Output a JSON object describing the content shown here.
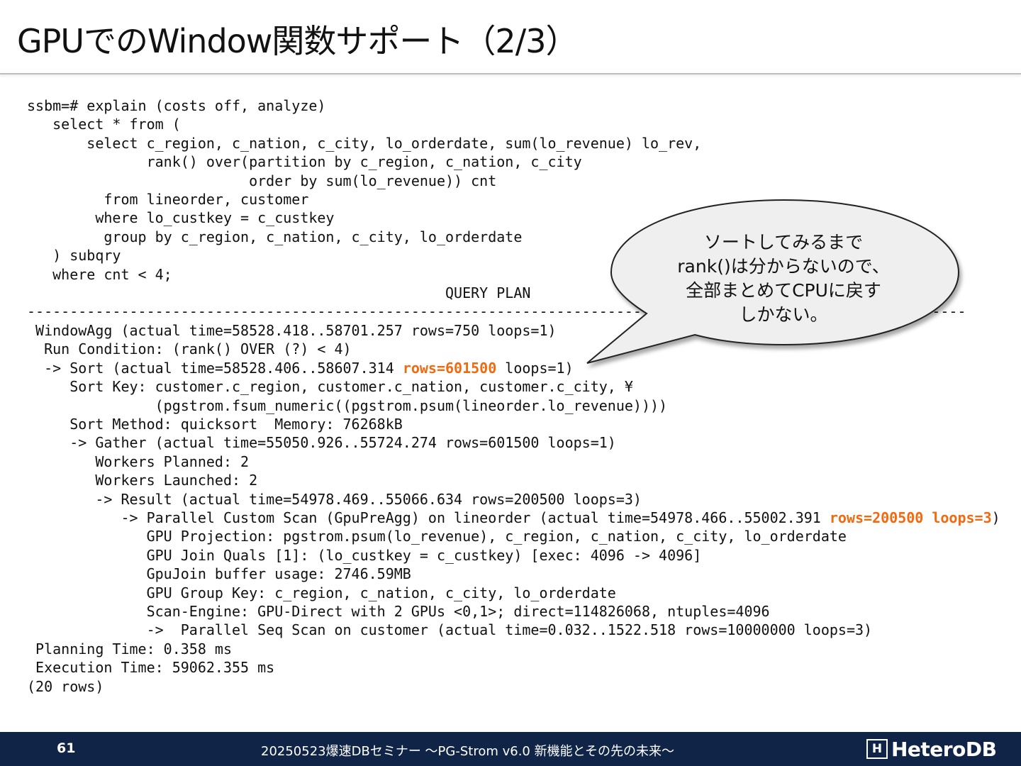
{
  "slide": {
    "title": "GPUでのWindow関数サポート（2/3）"
  },
  "code_lines": [
    "ssbm=# explain (costs off, analyze)",
    "   select * from (",
    "       select c_region, c_nation, c_city, lo_orderdate, sum(lo_revenue) lo_rev,",
    "              rank() over(partition by c_region, c_nation, c_city",
    "                          order by sum(lo_revenue)) cnt",
    "         from lineorder, customer",
    "        where lo_custkey = c_custkey",
    "         group by c_region, c_nation, c_city, lo_orderdate",
    "   ) subqry",
    "   where cnt < 4;",
    "                                                 QUERY PLAN",
    "--------------------------------------------------------------------------------------------------------------",
    " WindowAgg (actual time=58528.418..58701.257 rows=750 loops=1)",
    "  Run Condition: (rank() OVER (?) < 4)",
    "  -> Sort (actual time=58528.406..58607.314 ",
    "     Sort Key: customer.c_region, customer.c_nation, customer.c_city, ¥",
    "               (pgstrom.fsum_numeric((pgstrom.psum(lineorder.lo_revenue))))",
    "     Sort Method: quicksort  Memory: 76268kB",
    "     -> Gather (actual time=55050.926..55724.274 rows=601500 loops=1)",
    "        Workers Planned: 2",
    "        Workers Launched: 2",
    "        -> Result (actual time=54978.469..55066.634 rows=200500 loops=3)",
    "           -> Parallel Custom Scan (GpuPreAgg) on lineorder (actual time=54978.466..55002.391 ",
    "              GPU Projection: pgstrom.psum(lo_revenue), c_region, c_nation, c_city, lo_orderdate",
    "              GPU Join Quals [1]: (lo_custkey = c_custkey) [exec: 4096 -> 4096]",
    "              GpuJoin buffer usage: 2746.59MB",
    "              GPU Group Key: c_region, c_nation, c_city, lo_orderdate",
    "              Scan-Engine: GPU-Direct with 2 GPUs <0,1>; direct=114826068, ntuples=4096",
    "              ->  Parallel Seq Scan on customer (actual time=0.032..1522.518 rows=10000000 loops=3)",
    " Planning Time: 0.358 ms",
    " Execution Time: 59062.355 ms",
    "(20 rows)"
  ],
  "highlights": {
    "sort_rows": "rows=601500",
    "sort_tail": " loops=1)",
    "scan_rows_loops": "rows=200500 loops=3",
    "scan_tail": ")"
  },
  "callout": {
    "line1": "ソートしてみるまで",
    "line2": "rank()は分からないので、",
    "line3": "全部まとめてCPUに戻す",
    "line4": "しかない。"
  },
  "footer": {
    "page_number": "61",
    "seminar": "20250523爆速DBセミナー ～PG-Strom v6.0  新機能とその先の未来～",
    "logo_text": "HeteroDB",
    "logo_mark": "H"
  },
  "colors": {
    "highlight": "#f06a0f",
    "footer_bg": "#0f2447"
  }
}
